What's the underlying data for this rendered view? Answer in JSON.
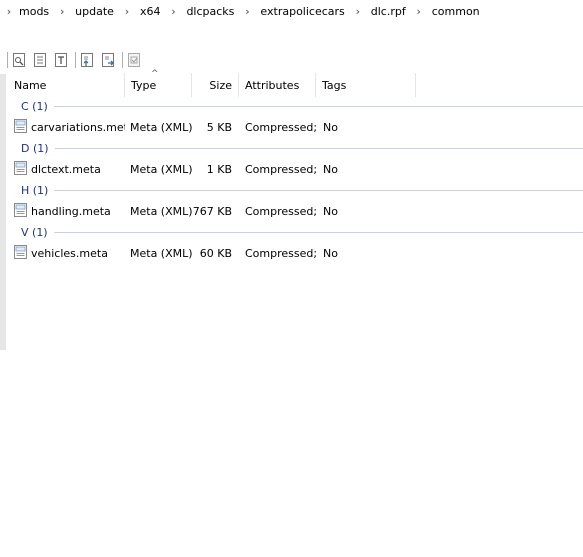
{
  "breadcrumb": [
    "mods",
    "update",
    "x64",
    "dlcpacks",
    "extrapolicecars",
    "dlc.rpf",
    "common"
  ],
  "toolbar": {
    "icons": [
      "view-icon",
      "properties-icon",
      "text-icon",
      "import-icon",
      "export-icon",
      "defragment-icon"
    ]
  },
  "columns": {
    "name": "Name",
    "type": "Type",
    "sort_indicator": "^",
    "size": "Size",
    "attributes": "Attributes",
    "tags": "Tags"
  },
  "groups": [
    {
      "label": "C (1)",
      "files": [
        {
          "name": "carvariations.meta",
          "type": "Meta (XML)",
          "size": "5 KB",
          "attributes": "Compressed;",
          "tags": "No"
        }
      ]
    },
    {
      "label": "D (1)",
      "files": [
        {
          "name": "dlctext.meta",
          "type": "Meta (XML)",
          "size": "1 KB",
          "attributes": "Compressed;",
          "tags": "No"
        }
      ]
    },
    {
      "label": "H (1)",
      "files": [
        {
          "name": "handling.meta",
          "type": "Meta (XML)",
          "size": "767 KB",
          "attributes": "Compressed;",
          "tags": "No"
        }
      ]
    },
    {
      "label": "V (1)",
      "files": [
        {
          "name": "vehicles.meta",
          "type": "Meta (XML)",
          "size": "60 KB",
          "attributes": "Compressed;",
          "tags": "No"
        }
      ]
    }
  ],
  "colors": {
    "group_text": "#1e3287",
    "group_line": "#c8d2e6"
  }
}
